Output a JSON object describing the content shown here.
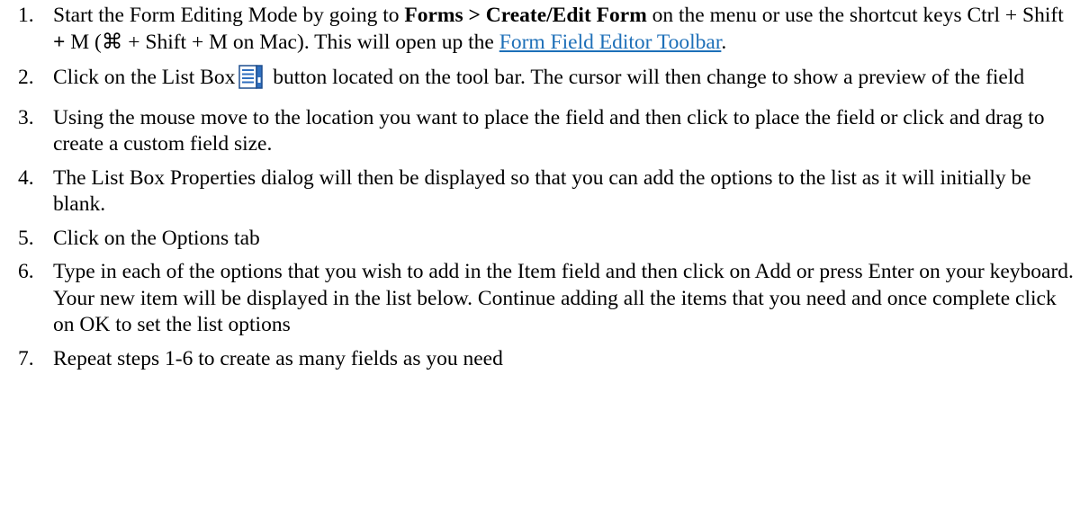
{
  "steps": [
    {
      "number": "1.",
      "text_1": "Start the Form Editing Mode by going to ",
      "bold": "Forms > Create/Edit Form",
      "text_2": " on the menu or use the shortcut keys Ctrl + Shift ",
      "plus_bold": "+",
      "text_3": " M (⌘ + Shift + M on Mac). This will open up the ",
      "link": "Form Field Editor Toolbar",
      "text_4": "."
    },
    {
      "number": "2.",
      "text_1": "Click on the List Box",
      "icon": "list-box-icon",
      "text_2": "button located on the tool bar. The cursor will then change to show a preview of the field"
    },
    {
      "number": "3.",
      "text": "Using the mouse move to the location you want to place the field and then click to place the field or click and drag to create a custom field size."
    },
    {
      "number": "4.",
      "text": "The List Box Properties dialog will then be displayed so that you can add the options to the list as it will initially be blank."
    },
    {
      "number": "5.",
      "text": "Click on the Options tab"
    },
    {
      "number": "6.",
      "text": "Type in each of the options that you wish to add in the Item field and then click on Add or press Enter on your keyboard. Your new item will be displayed in the list below. Continue adding all the items that you need and once complete click on OK to set the list options"
    },
    {
      "number": "7.",
      "text": "Repeat steps 1-6 to create as many fields as you need"
    }
  ],
  "colors": {
    "link": "#1d6fb8",
    "icon_fill": "#2f6fbf",
    "icon_border": "#1f4f8f"
  }
}
